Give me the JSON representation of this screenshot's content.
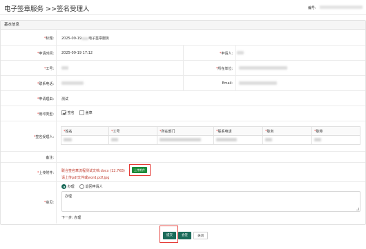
{
  "header": {
    "title": "电子签章服务 >>签名受理人",
    "doc_no_label": "编号:"
  },
  "section_title": "基本信息",
  "fields": {
    "title_label": "标题:",
    "title_prefix": "2025-09-19",
    "title_suffix": "电子签章服务",
    "apply_time_label": "申请时间:",
    "apply_time_value": "2025-09-19 17:12",
    "applicant_label": "申请人:",
    "employee_no_label": "工号:",
    "unit_label": "所在单位:",
    "phone_label": "联系电话:",
    "email_label": "Email:",
    "reason_label": "申请理由:",
    "reason_value": "测试",
    "seal_type_label": "用印类型:",
    "seal_options": [
      {
        "label": "签名",
        "checked": true
      },
      {
        "label": "盖章",
        "checked": false
      }
    ],
    "signer_label": "签名受理人:",
    "remark_label": "备注:",
    "attachment_label": "上传附件:",
    "opinion_label": "意见:"
  },
  "signer_table": {
    "headers": [
      "姓名",
      "工号",
      "所在部门",
      "联系电话",
      "职务",
      "职称"
    ]
  },
  "attachment": {
    "file_name": "联合签名章流程测试文档.docx (12.7KB)",
    "upload_button": "上传附件",
    "hint": "请上传pdf文件或word,pdf,jpg"
  },
  "opinion": {
    "options": [
      {
        "label": "办理",
        "selected": true
      },
      {
        "label": "退回申请人",
        "selected": false
      }
    ],
    "text": "办理",
    "next_step": "下一步: 办理"
  },
  "buttons": {
    "submit": "提交",
    "return": "会签",
    "close": "关闭"
  },
  "colors": {
    "primary": "#1b6b5a",
    "upload": "#1b8a3a",
    "highlight": "#e53935",
    "required": "#e53935"
  }
}
